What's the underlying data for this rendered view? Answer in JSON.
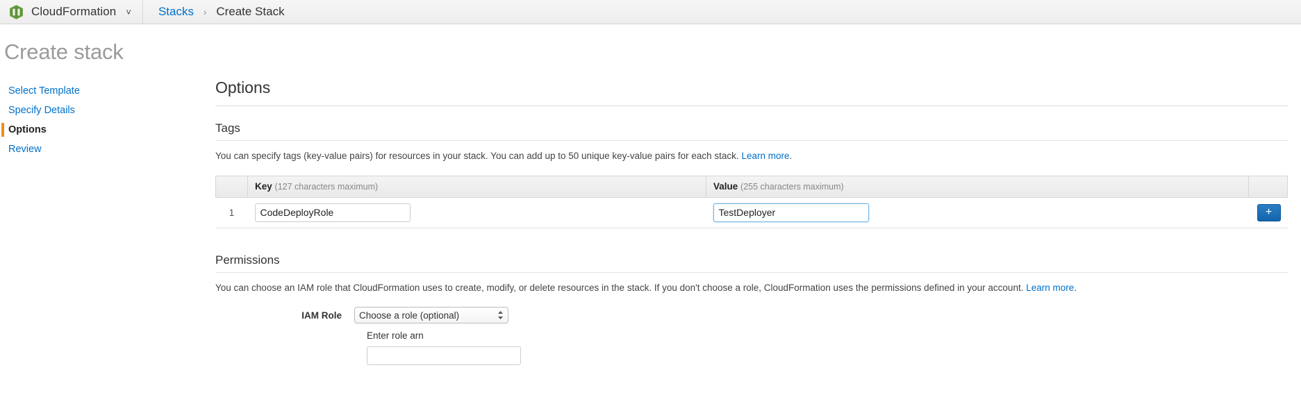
{
  "topbar": {
    "service_icon": "cloudformation-icon",
    "service_name": "CloudFormation",
    "service_chevron": "˅",
    "breadcrumb": {
      "root_label": "Stacks",
      "separator": "›",
      "current_label": "Create Stack"
    }
  },
  "page": {
    "title": "Create stack"
  },
  "sidebar": {
    "items": [
      {
        "label": "Select Template",
        "active": false
      },
      {
        "label": "Specify Details",
        "active": false
      },
      {
        "label": "Options",
        "active": true
      },
      {
        "label": "Review",
        "active": false
      }
    ]
  },
  "main": {
    "heading": "Options",
    "tags": {
      "heading": "Tags",
      "description": "You can specify tags (key-value pairs) for resources in your stack. You can add up to 50 unique key-value pairs for each stack.",
      "learn_more": "Learn more",
      "period": ".",
      "columns": {
        "number": "",
        "key_title": "Key",
        "key_hint": "(127 characters maximum)",
        "value_title": "Value",
        "value_hint": "(255 characters maximum)",
        "actions": ""
      },
      "rows": [
        {
          "number": "1",
          "key_value": "CodeDeployRole",
          "key_placeholder": "",
          "value_value": "TestDeployer",
          "value_placeholder": "",
          "value_focused": true
        }
      ],
      "add_button_label": "+"
    },
    "permissions": {
      "heading": "Permissions",
      "description": "You can choose an IAM role that CloudFormation uses to create, modify, or delete resources in the stack. If you don't choose a role, CloudFormation uses the permissions defined in your account.",
      "learn_more": "Learn more",
      "period": ".",
      "iam_role_label": "IAM Role",
      "iam_role_selected": "Choose a role (optional)",
      "iam_role_options": [
        "Choose a role (optional)"
      ],
      "arn_label": "Enter role arn",
      "arn_value": "",
      "arn_placeholder": ""
    }
  },
  "colors": {
    "link": "#0070c9",
    "accent_orange": "#f28d1c",
    "primary_button": "#1265ad",
    "focus_border": "#6fb3e5",
    "icon_green": "#6aa84f"
  }
}
